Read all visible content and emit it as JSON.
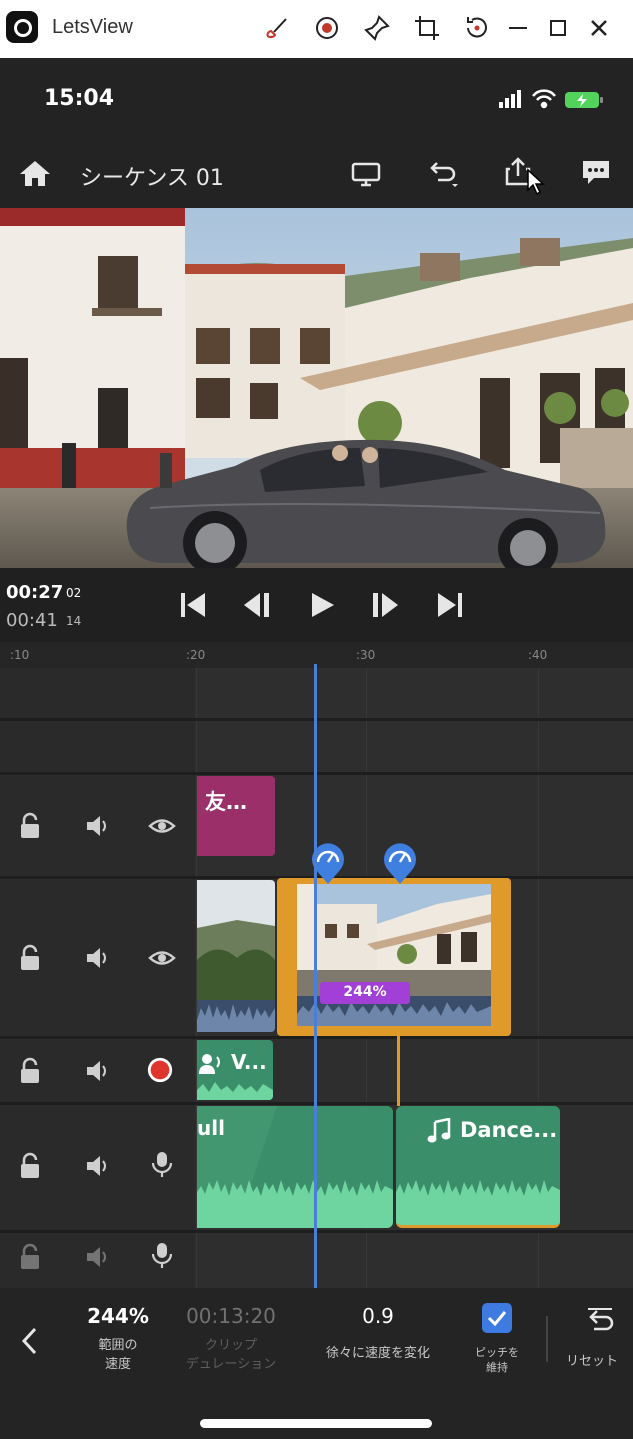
{
  "window": {
    "title": "LetsView",
    "toolbar_icons": [
      "brush-icon",
      "record-icon",
      "pin-icon",
      "crop-icon",
      "rotate-icon",
      "minimize-icon",
      "maximize-icon",
      "close-icon"
    ]
  },
  "status_bar": {
    "time": "15:04"
  },
  "header": {
    "title": "シーケンス 01"
  },
  "transport": {
    "current_time": "00:27",
    "current_frames": "02",
    "total_time": "00:41",
    "total_frames": "14"
  },
  "ruler": {
    "ticks": [
      ":10",
      ":20",
      ":30",
      ":40"
    ]
  },
  "clips": {
    "title_clip": "友…",
    "speed_badge": "244%",
    "voice_clip": "V...",
    "audio_clip_a": "ull",
    "audio_clip_b": "Dance..."
  },
  "toolbar": {
    "speed_value": "244%",
    "speed_label_line1": "範囲の",
    "speed_label_line2": "速度",
    "duration_value": "00:13:20",
    "duration_label_line1": "クリップ",
    "duration_label_line2": "デュレーション",
    "ramp_value": "0.9",
    "ramp_label": "徐々に速度を変化",
    "pitch_label_line1": "ピッチを",
    "pitch_label_line2": "維持",
    "reset_label": "リセット"
  },
  "colors": {
    "title_clip": "#9b2f6a",
    "audio_clip": "#3a8f6a",
    "selection": "#e09a2a",
    "playhead": "#4a7fd8",
    "speed_badge": "#a23fd6",
    "checkbox": "#3d7be0"
  }
}
